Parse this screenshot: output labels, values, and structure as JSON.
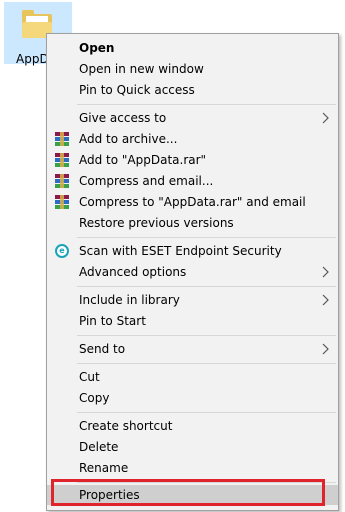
{
  "desktop": {
    "icon_label": "AppD"
  },
  "menu": {
    "items": [
      {
        "label": "Open"
      },
      {
        "label": "Open in new window"
      },
      {
        "label": "Pin to Quick access"
      },
      {
        "label": "Give access to"
      },
      {
        "label": "Add to archive..."
      },
      {
        "label": "Add to \"AppData.rar\""
      },
      {
        "label": "Compress and email..."
      },
      {
        "label": "Compress to \"AppData.rar\" and email"
      },
      {
        "label": "Restore previous versions"
      },
      {
        "label": "Scan with ESET Endpoint Security"
      },
      {
        "label": "Advanced options"
      },
      {
        "label": "Include in library"
      },
      {
        "label": "Pin to Start"
      },
      {
        "label": "Send to"
      },
      {
        "label": "Cut"
      },
      {
        "label": "Copy"
      },
      {
        "label": "Create shortcut"
      },
      {
        "label": "Delete"
      },
      {
        "label": "Rename"
      },
      {
        "label": "Properties"
      }
    ]
  },
  "icons": {
    "archive": "winrar-icon",
    "scan": "eset-icon",
    "submenu": "chevron-right-icon"
  },
  "colors": {
    "highlight": "#e0242b",
    "selected": "#cfcfcf",
    "menu_bg": "#f2f2f2"
  }
}
